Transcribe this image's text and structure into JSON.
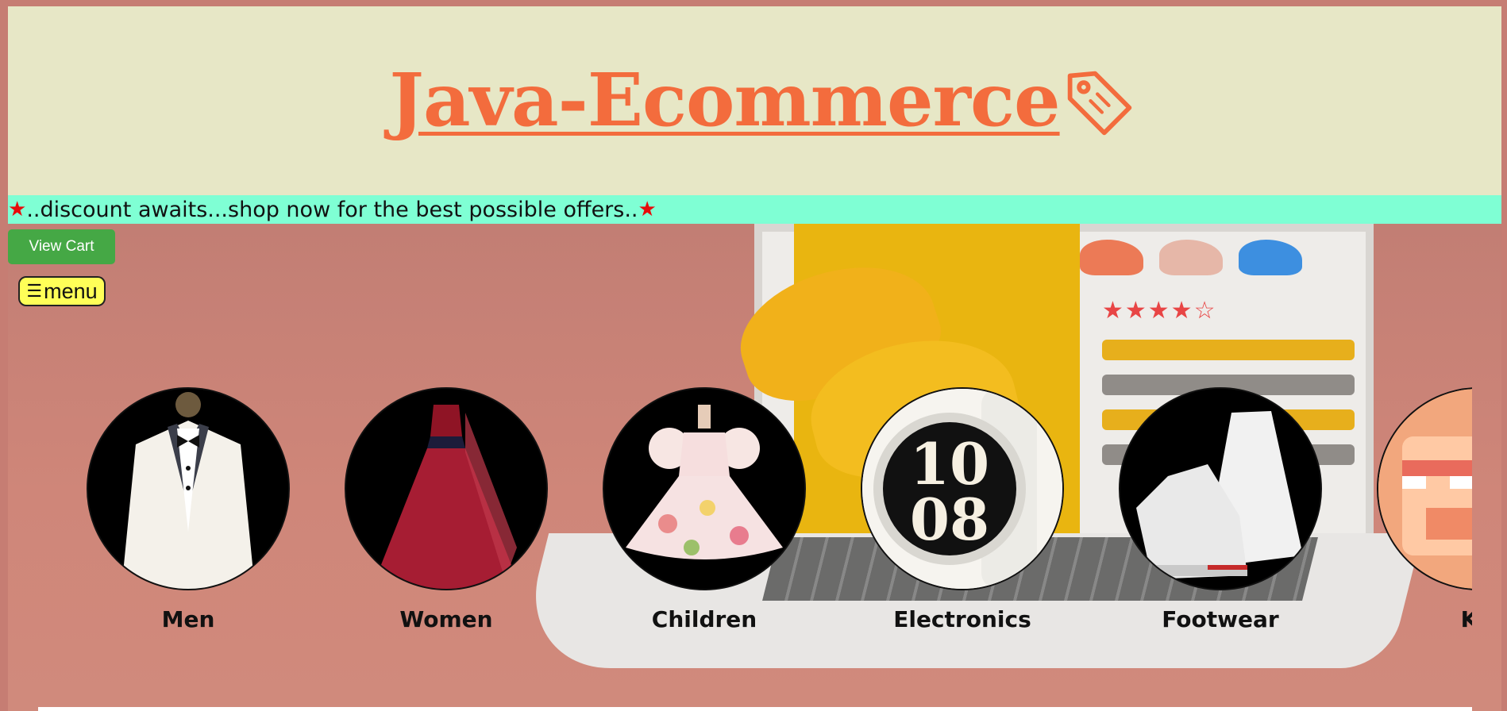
{
  "header": {
    "brand_title": "Java-Ecommerce",
    "brand_icon": "tag-icon",
    "title_color": "#f36c3d",
    "background": "#e7e7c6"
  },
  "marquee": {
    "star_left": "★",
    "text": "..discount awaits...shop now for the best possible offers..",
    "star_right": "★",
    "background": "#7fffd4",
    "star_color": "#e70b0b"
  },
  "toolbar": {
    "view_cart_label": "View Cart",
    "menu_icon": "☰",
    "menu_label": "menu"
  },
  "categories": [
    {
      "label": "Men",
      "icon": "tuxedo-image"
    },
    {
      "label": "Women",
      "icon": "gown-image"
    },
    {
      "label": "Children",
      "icon": "dress-image"
    },
    {
      "label": "Electronics",
      "icon": "smartwatch-image"
    },
    {
      "label": "Footwear",
      "icon": "sneaker-image"
    },
    {
      "label": "Kit",
      "icon": "shop-image"
    }
  ],
  "hero": {
    "rating_stars": "★★★★☆"
  }
}
